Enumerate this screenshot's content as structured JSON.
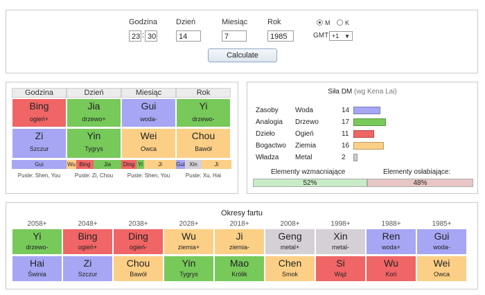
{
  "form": {
    "hour_label": "Godzina",
    "hour": "23",
    "colon": ":",
    "minute": "30",
    "day_label": "Dzień",
    "day": "14",
    "month_label": "Miesiąc",
    "month": "7",
    "year_label": "Rok",
    "year": "1985",
    "gender_m": "M",
    "gender_k": "K",
    "gmt_label": "GMT",
    "gmt_value": "+1",
    "calculate": "Calculate"
  },
  "pillars": {
    "headers": [
      "Godzina",
      "Dzień",
      "Miesiąc",
      "Rok"
    ],
    "stems": [
      {
        "name": "Bing",
        "el": "ogień+",
        "color": "red"
      },
      {
        "name": "Jia",
        "el": "drzewo+",
        "color": "green"
      },
      {
        "name": "Gui",
        "el": "woda-",
        "color": "blue"
      },
      {
        "name": "Yi",
        "el": "drzewo-",
        "color": "green"
      }
    ],
    "branches": [
      {
        "name": "Zi",
        "el": "Szczur",
        "color": "blue"
      },
      {
        "name": "Yin",
        "el": "Tygrys",
        "color": "green"
      },
      {
        "name": "Wei",
        "el": "Owca",
        "color": "orange"
      },
      {
        "name": "Chou",
        "el": "Bawół",
        "color": "orange"
      }
    ],
    "hidden": [
      [
        {
          "t": "Gui",
          "c": "blue",
          "w": 1
        }
      ],
      [
        {
          "t": "Wu",
          "c": "orange",
          "w": 0.18
        },
        {
          "t": "Bing",
          "c": "red",
          "w": 0.32
        },
        {
          "t": "Jia",
          "c": "green",
          "w": 0.5
        }
      ],
      [
        {
          "t": "Ding",
          "c": "red",
          "w": 0.28
        },
        {
          "t": "Yi",
          "c": "green",
          "w": 0.14
        },
        {
          "t": "Ji",
          "c": "orange",
          "w": 0.58
        }
      ],
      [
        {
          "t": "Gui",
          "c": "blue",
          "w": 0.16
        },
        {
          "t": "Xin",
          "c": "gray",
          "w": 0.3
        },
        {
          "t": "Ji",
          "c": "orange",
          "w": 0.54
        }
      ]
    ],
    "empty": [
      "Puste: Shen, You",
      "Puste: Zi, Chou",
      "Puste: Shen, You",
      "Puste: Xu, Hai"
    ]
  },
  "strength": {
    "title": "Siła DM",
    "subtitle": "(wg Kena Lai)",
    "rows": [
      {
        "label": "Zasoby",
        "element": "Woda",
        "value": 14,
        "color": "#a6a6f4"
      },
      {
        "label": "Analogia",
        "element": "Drzewo",
        "value": 17,
        "color": "#77c95a"
      },
      {
        "label": "Dzieło",
        "element": "Ogień",
        "value": 11,
        "color": "#f06565"
      },
      {
        "label": "Bogactwo",
        "element": "Ziemia",
        "value": 16,
        "color": "#fccf86"
      },
      {
        "label": "Władza",
        "element": "Metal",
        "value": 2,
        "color": "#cccccc"
      }
    ],
    "strengthening_label": "Elementy wzmacniające",
    "weakening_label": "Elementy osłabiające:",
    "strengthening_pct": "52%",
    "weakening_pct": "48%",
    "strengthening_frac": 0.52,
    "strengthening_color": "#c8ecc8",
    "weakening_color": "#e8c6c6"
  },
  "luck": {
    "title": "Okresy fartu",
    "years": [
      "2058+",
      "2048+",
      "2038+",
      "2028+",
      "2018+",
      "2008+",
      "1998+",
      "1988+",
      "1985+"
    ],
    "stems": [
      {
        "name": "Yi",
        "el": "drzewo-",
        "color": "green"
      },
      {
        "name": "Bing",
        "el": "ogień+",
        "color": "red"
      },
      {
        "name": "Ding",
        "el": "ogień-",
        "color": "red"
      },
      {
        "name": "Wu",
        "el": "ziemia+",
        "color": "orange"
      },
      {
        "name": "Ji",
        "el": "ziemia-",
        "color": "orange"
      },
      {
        "name": "Geng",
        "el": "metal+",
        "color": "gray"
      },
      {
        "name": "Xin",
        "el": "metal-",
        "color": "gray"
      },
      {
        "name": "Ren",
        "el": "woda+",
        "color": "blue"
      },
      {
        "name": "Gui",
        "el": "woda-",
        "color": "blue"
      }
    ],
    "branches": [
      {
        "name": "Hai",
        "el": "Świnia",
        "color": "blue"
      },
      {
        "name": "Zi",
        "el": "Szczur",
        "color": "blue"
      },
      {
        "name": "Chou",
        "el": "Bawół",
        "color": "orange"
      },
      {
        "name": "Yin",
        "el": "Tygrys",
        "color": "green"
      },
      {
        "name": "Mao",
        "el": "Królik",
        "color": "green"
      },
      {
        "name": "Chen",
        "el": "Smok",
        "color": "orange"
      },
      {
        "name": "Si",
        "el": "Wąż",
        "color": "red"
      },
      {
        "name": "Wu",
        "el": "Koń",
        "color": "red"
      },
      {
        "name": "Wei",
        "el": "Owca",
        "color": "orange"
      }
    ]
  }
}
